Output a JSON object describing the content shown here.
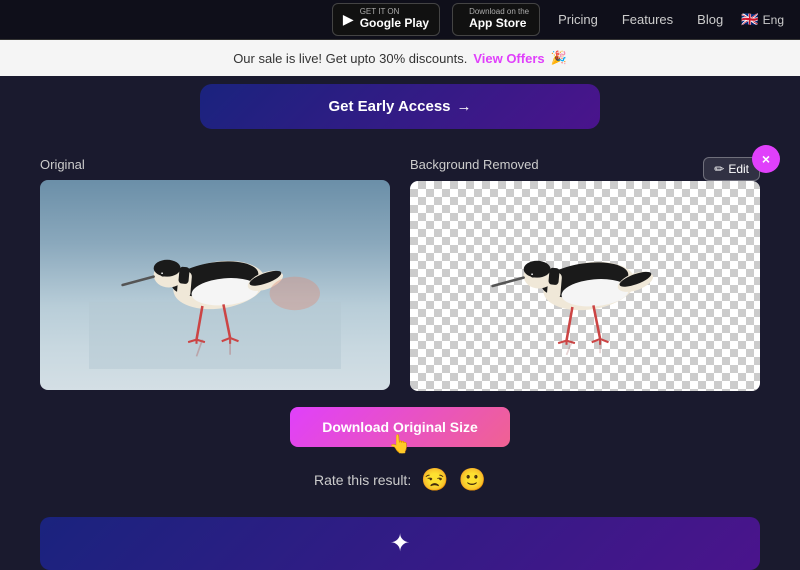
{
  "nav": {
    "google_play_label_small": "GET IT ON",
    "google_play_label_main": "Google Play",
    "app_store_label_small": "Download on the",
    "app_store_label_main": "App Store",
    "pricing_label": "Pricing",
    "features_label": "Features",
    "blog_label": "Blog",
    "lang_label": "Eng"
  },
  "sale_banner": {
    "text": "Our sale is live! Get upto 30% discounts.",
    "link_text": "View Offers",
    "emoji": "🎉"
  },
  "early_access": {
    "button_label": "Get Early Access",
    "arrow": "→"
  },
  "close_button": {
    "label": "×"
  },
  "comparison": {
    "original_label": "Original",
    "removed_label": "Background Removed",
    "edit_label": "✏ Edit"
  },
  "download": {
    "button_label": "Download Original Size"
  },
  "rating": {
    "label": "Rate this result:",
    "emoji_sad": "😒",
    "emoji_neutral": "🙂"
  }
}
